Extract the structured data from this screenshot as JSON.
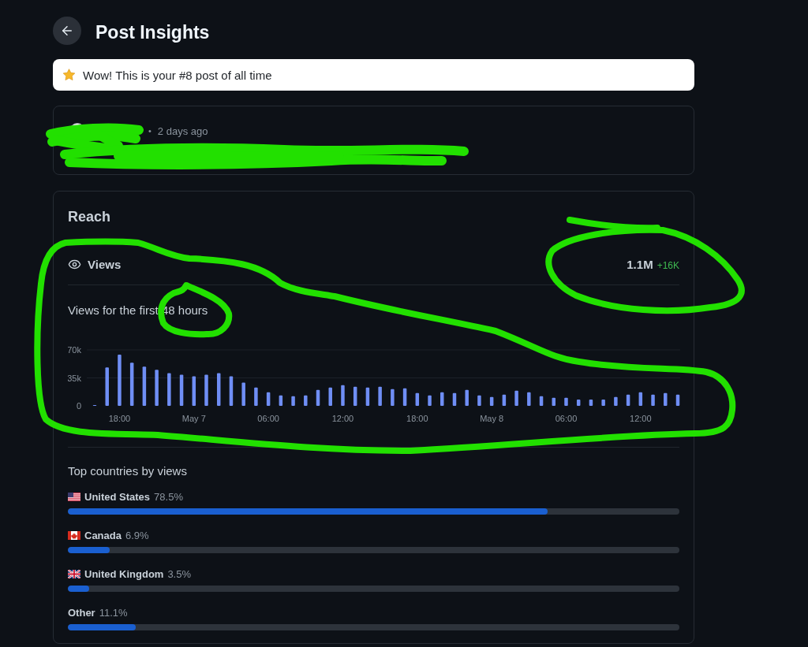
{
  "header": {
    "title": "Post Insights"
  },
  "banner": {
    "text": "Wow! This is your #8 post of all time"
  },
  "post": {
    "separator": "•",
    "time": "2 days ago"
  },
  "reach": {
    "title": "Reach",
    "metric": {
      "label": "Views",
      "value": "1.1M",
      "change": "+16K"
    },
    "chart_data": {
      "type": "bar",
      "title": "Views for the first 48 hours",
      "categories": [
        null,
        null,
        "18:00",
        null,
        null,
        null,
        null,
        null,
        "May 7",
        null,
        null,
        null,
        null,
        null,
        "06:00",
        null,
        null,
        null,
        null,
        null,
        "12:00",
        null,
        null,
        null,
        null,
        null,
        "18:00",
        null,
        null,
        null,
        null,
        null,
        "May 8",
        null,
        null,
        null,
        null,
        null,
        "06:00",
        null,
        null,
        null,
        null,
        null,
        "12:00",
        null,
        null,
        null
      ],
      "values": [
        1000,
        48000,
        64000,
        54000,
        49000,
        45000,
        41000,
        39000,
        37000,
        39000,
        41000,
        37000,
        29000,
        23000,
        17000,
        13000,
        12000,
        13000,
        20000,
        23000,
        26000,
        24000,
        23000,
        24000,
        21000,
        22000,
        16000,
        13000,
        17000,
        16000,
        20000,
        13000,
        11000,
        14000,
        19000,
        17000,
        12000,
        10000,
        10000,
        8000,
        8000,
        8000,
        11000,
        14000,
        17000,
        14000,
        16000,
        14000
      ],
      "ylim": [
        0,
        70000
      ],
      "yticks": [
        0,
        {
          "value": 35000,
          "label": "35k"
        },
        {
          "value": 70000,
          "label": "70k"
        }
      ]
    },
    "countries_title": "Top countries by views",
    "countries": [
      {
        "name": "United States",
        "share": "78.5%",
        "level": 0.785,
        "kind": "us"
      },
      {
        "name": "Canada",
        "share": "6.9%",
        "level": 0.069,
        "kind": "ca"
      },
      {
        "name": "United Kingdom",
        "share": "3.5%",
        "level": 0.035,
        "kind": "gb"
      },
      {
        "name": "Other",
        "share": "11.1%",
        "level": 0.111,
        "kind": "plain"
      }
    ]
  },
  "annotations": [
    {
      "kind": "scribble"
    },
    {
      "kind": "loop"
    },
    {
      "kind": "loop"
    },
    {
      "kind": "loop"
    }
  ]
}
